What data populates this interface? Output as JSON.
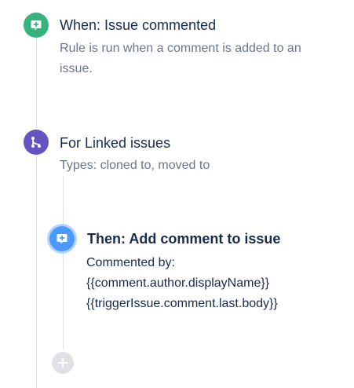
{
  "trigger": {
    "icon": "comment-plus-icon",
    "color": "#36b37e",
    "title": "When: Issue commented",
    "description": "Rule is run when a comment is added to an issue."
  },
  "branch": {
    "icon": "branch-icon",
    "color": "#6554c0",
    "title": "For Linked issues",
    "description": "Types: cloned to, moved to"
  },
  "action": {
    "icon": "comment-plus-icon",
    "color": "#4c9aff",
    "title": "Then: Add comment to issue",
    "lines": [
      "Commented by:",
      "{{comment.author.displayName}}",
      "{{triggerIssue.comment.last.body}}"
    ]
  },
  "add_step": {
    "icon": "plus-icon"
  }
}
